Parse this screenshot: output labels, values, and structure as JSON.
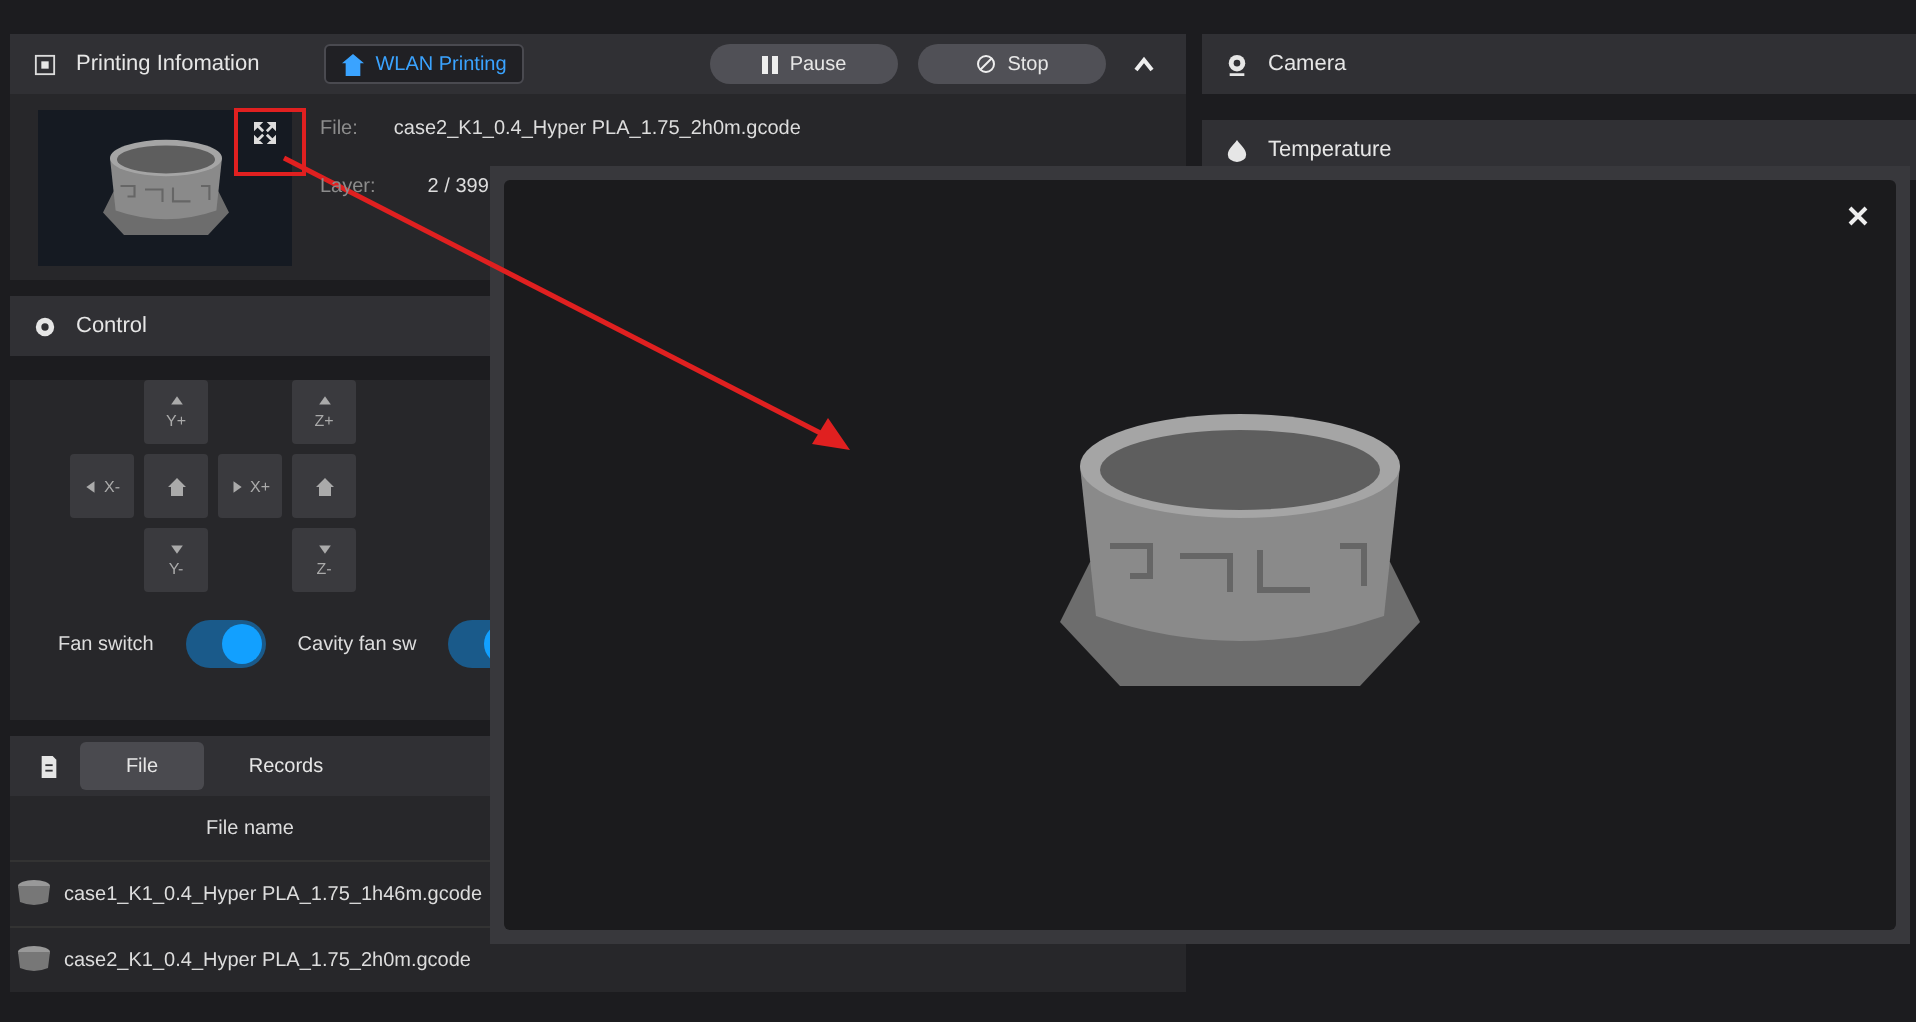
{
  "print_panel": {
    "title": "Printing Infomation",
    "wlan_button": "WLAN Printing",
    "pause_button": "Pause",
    "stop_button": "Stop",
    "file_label": "File:",
    "file_value": "case2_K1_0.4_Hyper PLA_1.75_2h0m.gcode",
    "layer_label": "Layer:",
    "layer_value": "2 / 399"
  },
  "control_panel": {
    "title": "Control",
    "jog_rows": [
      [
        {
          "kind": "blank"
        },
        {
          "kind": "up",
          "label": "Y+"
        },
        {
          "kind": "blank"
        },
        {
          "kind": "up",
          "label": "Z+"
        }
      ],
      [
        {
          "kind": "left",
          "label": "X-"
        },
        {
          "kind": "home"
        },
        {
          "kind": "right",
          "label": "X+"
        },
        {
          "kind": "home"
        }
      ],
      [
        {
          "kind": "blank"
        },
        {
          "kind": "down",
          "label": "Y-"
        },
        {
          "kind": "blank"
        },
        {
          "kind": "down",
          "label": "Z-"
        }
      ]
    ],
    "switches": [
      {
        "label": "Fan switch",
        "on": true
      },
      {
        "label": "Cavity fan sw",
        "on": true
      }
    ]
  },
  "files_panel": {
    "tabs": [
      {
        "label": "File",
        "selected": true
      },
      {
        "label": "Records",
        "selected": false
      }
    ],
    "column": "File name",
    "rows": [
      {
        "name": "case1_K1_0.4_Hyper PLA_1.75_1h46m.gcode"
      },
      {
        "name": "case2_K1_0.4_Hyper PLA_1.75_2h0m.gcode"
      }
    ]
  },
  "right_panels": [
    {
      "kind": "camera",
      "title": "Camera"
    },
    {
      "kind": "temperature",
      "title": "Temperature"
    }
  ]
}
